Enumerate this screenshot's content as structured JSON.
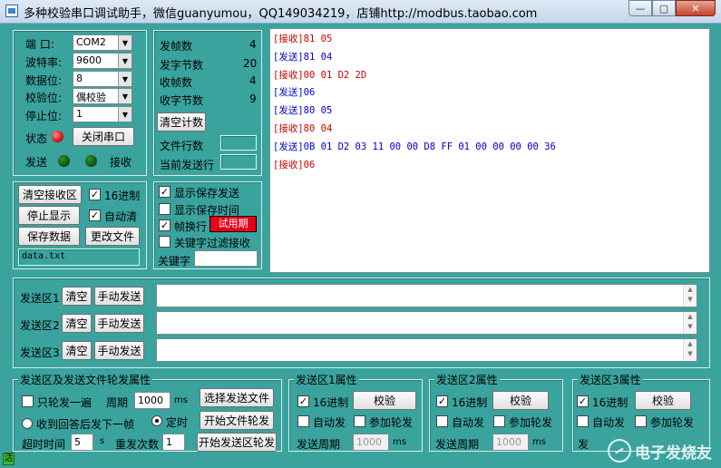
{
  "title": "多种校验串口调试助手，微信guanyumou，QQ149034219，店铺http://modbus.taobao.com",
  "window": {
    "min": "—",
    "max": "▢",
    "close": "✕"
  },
  "serial": {
    "port_label": "端  口:",
    "port_value": "COM2",
    "baud_label": "波特率:",
    "baud_value": "9600",
    "data_label": "数据位:",
    "data_value": "8",
    "parity_label": "校验位:",
    "parity_value": "偶校验",
    "stop_label": "停止位:",
    "stop_value": "1",
    "state_label": "状态",
    "close_button": "关闭串口",
    "send_label": "发送",
    "recv_label": "接收",
    "state_color": "#e01818",
    "indicator_color": "#0b5e0b"
  },
  "counters": {
    "tx_frames_label": "发帧数",
    "tx_frames": "4",
    "tx_bytes_label": "发字节数",
    "tx_bytes": "20",
    "rx_frames_label": "收帧数",
    "rx_frames": "4",
    "rx_bytes_label": "收字节数",
    "rx_bytes": "9",
    "clear_button": "清空计数",
    "file_lines_label": "文件行数",
    "current_line_label": "当前发送行"
  },
  "recv_controls": {
    "clear_recv": "清空接收区",
    "hex_label": "16进制",
    "stop_display": "停止显示",
    "auto_clear_label": "自动清",
    "save_data": "保存数据",
    "change_file": "更改文件",
    "file_name": "data.txt"
  },
  "display_options": {
    "show_save_send": "显示保存发送",
    "show_save_time": "显示保存时间",
    "frame_newline": "帧换行",
    "badge": "试用期",
    "keyword_filter": "关键字过滤接收",
    "keyword_label": "关键字"
  },
  "log": [
    {
      "dir": "rx",
      "tag": "[接收]",
      "data": "81 05"
    },
    {
      "dir": "tx",
      "tag": "[发送]",
      "data": "81 04"
    },
    {
      "dir": "rx",
      "tag": "[接收]",
      "data": "00 01 D2 2D"
    },
    {
      "dir": "tx",
      "tag": "[发送]",
      "data": "06"
    },
    {
      "dir": "tx",
      "tag": "[发送]",
      "data": "80 05"
    },
    {
      "dir": "rx",
      "tag": "[接收]",
      "data": "80 04"
    },
    {
      "dir": "tx",
      "tag": "[发送]",
      "data": "0B 01 D2 03 11 00 00 D8 FF 01 00 00 00 00 36"
    },
    {
      "dir": "rx",
      "tag": "[接收]",
      "data": "06"
    }
  ],
  "send_areas": [
    {
      "label": "发送区1",
      "clear": "清空",
      "manual": "手动发送",
      "value": ""
    },
    {
      "label": "发送区2",
      "clear": "清空",
      "manual": "手动发送",
      "value": ""
    },
    {
      "label": "发送区3",
      "clear": "清空",
      "manual": "手动发送",
      "value": ""
    }
  ],
  "poll_group": {
    "title": "发送区及发送文件轮发属性",
    "only_once": "只轮发一遍",
    "period_label": "周期",
    "period_value": "1000",
    "period_unit": "ms",
    "select_file": "选择发送文件",
    "after_reply": "收到回答后发下一帧",
    "timed": "定时",
    "start_file": "开始文件轮发",
    "timeout_label": "超时时间",
    "timeout_value": "5",
    "timeout_unit": "s",
    "retry_label": "重发次数",
    "retry_value": "1",
    "start_area": "开始发送区轮发"
  },
  "area_props": [
    {
      "title": "发送区1属性",
      "hex": "16进制",
      "check": "校验",
      "auto": "自动发",
      "join": "参加轮发",
      "period_label": "发送周期",
      "period_value": "1000",
      "unit": "ms"
    },
    {
      "title": "发送区2属性",
      "hex": "16进制",
      "check": "校验",
      "auto": "自动发",
      "join": "参加轮发",
      "period_label": "发送周期",
      "period_value": "1000",
      "unit": "ms"
    },
    {
      "title": "发送区3属性",
      "hex": "16进制",
      "check": "校验",
      "auto": "自动发",
      "join": "参加轮发",
      "period_label": "发",
      "period_value": "",
      "unit": ""
    }
  ],
  "status_char": "活",
  "watermark": "电子发烧友"
}
